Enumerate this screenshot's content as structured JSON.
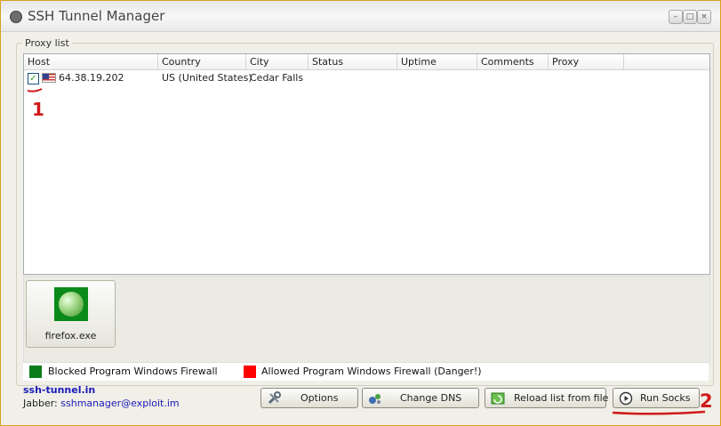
{
  "window": {
    "title": "SSH Tunnel Manager"
  },
  "proxy_list": {
    "label": "Proxy list",
    "columns": [
      "Host",
      "Country",
      "City",
      "Status",
      "Uptime",
      "Comments",
      "Proxy"
    ],
    "rows": [
      {
        "checked": true,
        "flag": "us-flag-icon",
        "host": "64.38.19.202",
        "country": "US (United States)",
        "city": "Cedar Falls",
        "status": "",
        "uptime": "",
        "comments": "",
        "proxy": ""
      }
    ]
  },
  "annotations": {
    "mark1": "1",
    "mark2": "2",
    "color": "#d01a1a"
  },
  "programs": [
    {
      "name": "firefox.exe",
      "icon": "firefox-icon"
    }
  ],
  "legend": [
    {
      "color": "#0b7d1c",
      "label": "Blocked Program Windows Firewall"
    },
    {
      "color": "#ff0000",
      "label": "Allowed Program Windows Firewall (Danger!)"
    }
  ],
  "footer": {
    "site": "ssh-tunnel.in",
    "jabber_label": "Jabber:",
    "jabber_email": "sshmanager@exploit.im"
  },
  "buttons": {
    "options": "Options",
    "change_dns": "Change DNS",
    "reload": "Reload list from file",
    "run_socks": "Run Socks"
  }
}
